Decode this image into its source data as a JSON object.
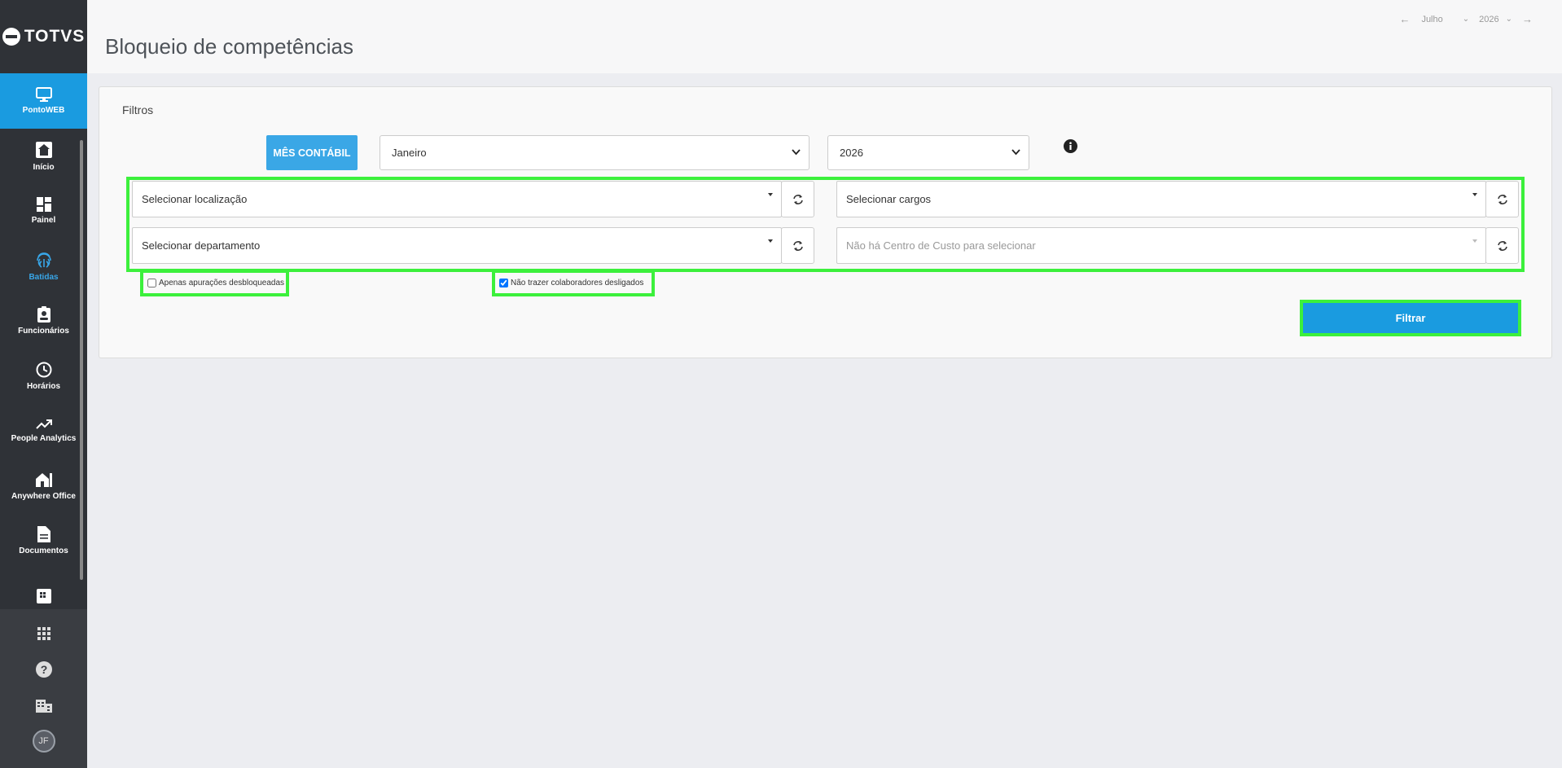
{
  "app": {
    "logo_text": "TOTVS",
    "product": "PontoWEB"
  },
  "sidebar": {
    "items": [
      {
        "label": "Início",
        "icon": "home-icon"
      },
      {
        "label": "Painel",
        "icon": "dashboard-icon"
      },
      {
        "label": "Batidas",
        "icon": "fingerprint-icon",
        "active": true
      },
      {
        "label": "Funcionários",
        "icon": "badge-icon"
      },
      {
        "label": "Horários",
        "icon": "clock-icon"
      },
      {
        "label": "People Analytics",
        "icon": "trending-up-icon"
      },
      {
        "label": "Anywhere Office",
        "icon": "house-icon"
      },
      {
        "label": "Documentos",
        "icon": "document-icon"
      }
    ],
    "bottom_icons": [
      "apps-grid-icon",
      "help-icon",
      "building-icon"
    ],
    "avatar_initials": "JF"
  },
  "header": {
    "title": "Bloqueio de competências",
    "period_month": "Julho",
    "period_year": "2026"
  },
  "filters": {
    "title": "Filtros",
    "mes_contabil_label": "MÊS CONTÁBIL",
    "month_select": "Janeiro",
    "year_select": "2026",
    "localizacao": "Selecionar localização",
    "cargos": "Selecionar cargos",
    "departamento": "Selecionar departamento",
    "centro_custo": "Não há Centro de Custo para selecionar",
    "check_desbloqueadas": {
      "label": "Apenas apurações desbloqueadas",
      "checked": false
    },
    "check_desligados": {
      "label": "Não trazer colaboradores desligados",
      "checked": true
    },
    "filter_button": "Filtrar"
  },
  "colors": {
    "sidebar_bg": "#2f3237",
    "brand_blue": "#1a9be0",
    "mes_button": "#3aa7e6",
    "highlight": "#3cf03c"
  }
}
